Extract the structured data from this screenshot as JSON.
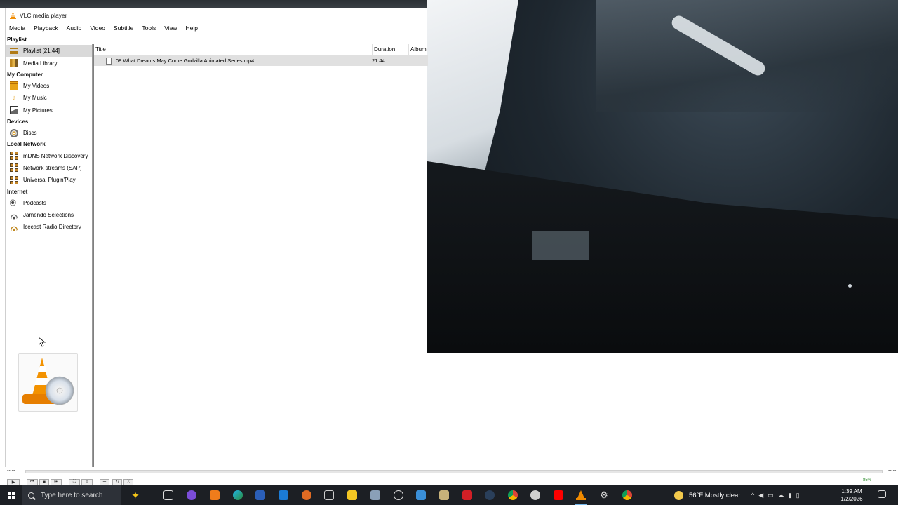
{
  "window": {
    "title": "VLC media player"
  },
  "menu": [
    "Media",
    "Playback",
    "Audio",
    "Video",
    "Subtitle",
    "Tools",
    "View",
    "Help"
  ],
  "sidebar": {
    "playlist_header": "Playlist",
    "playlist_items": [
      {
        "label": "Playlist [21:44]",
        "icon": "playlist-icon",
        "selected": true
      },
      {
        "label": "Media Library",
        "icon": "media-library-icon"
      }
    ],
    "mycomputer_header": "My Computer",
    "mycomputer_items": [
      {
        "label": "My Videos",
        "icon": "videos-icon"
      },
      {
        "label": "My Music",
        "icon": "music-icon"
      },
      {
        "label": "My Pictures",
        "icon": "pictures-icon"
      }
    ],
    "devices_header": "Devices",
    "devices_items": [
      {
        "label": "Discs",
        "icon": "disc-icon"
      }
    ],
    "localnet_header": "Local Network",
    "localnet_items": [
      {
        "label": "mDNS Network Discovery",
        "icon": "network-icon"
      },
      {
        "label": "Network streams (SAP)",
        "icon": "network-icon"
      },
      {
        "label": "Universal Plug'n'Play",
        "icon": "network-icon"
      }
    ],
    "internet_header": "Internet",
    "internet_items": [
      {
        "label": "Podcasts",
        "icon": "podcast-icon"
      },
      {
        "label": "Jamendo Selections",
        "icon": "jamendo-icon"
      },
      {
        "label": "Icecast Radio Directory",
        "icon": "icecast-icon"
      }
    ]
  },
  "playlist": {
    "columns": {
      "title": "Title",
      "duration": "Duration",
      "album": "Album"
    },
    "rows": [
      {
        "title": "08 What Dreams May Come Godzilla Animated Series.mp4",
        "duration": "21:44"
      }
    ]
  },
  "controls": {
    "time_elapsed": "--:--",
    "time_total": "--:--",
    "volume": "85%"
  },
  "taskbar": {
    "search_placeholder": "Type here to search",
    "weather": "56°F  Mostly clear",
    "time": "1:39 AM",
    "date": "1/2/2026"
  }
}
